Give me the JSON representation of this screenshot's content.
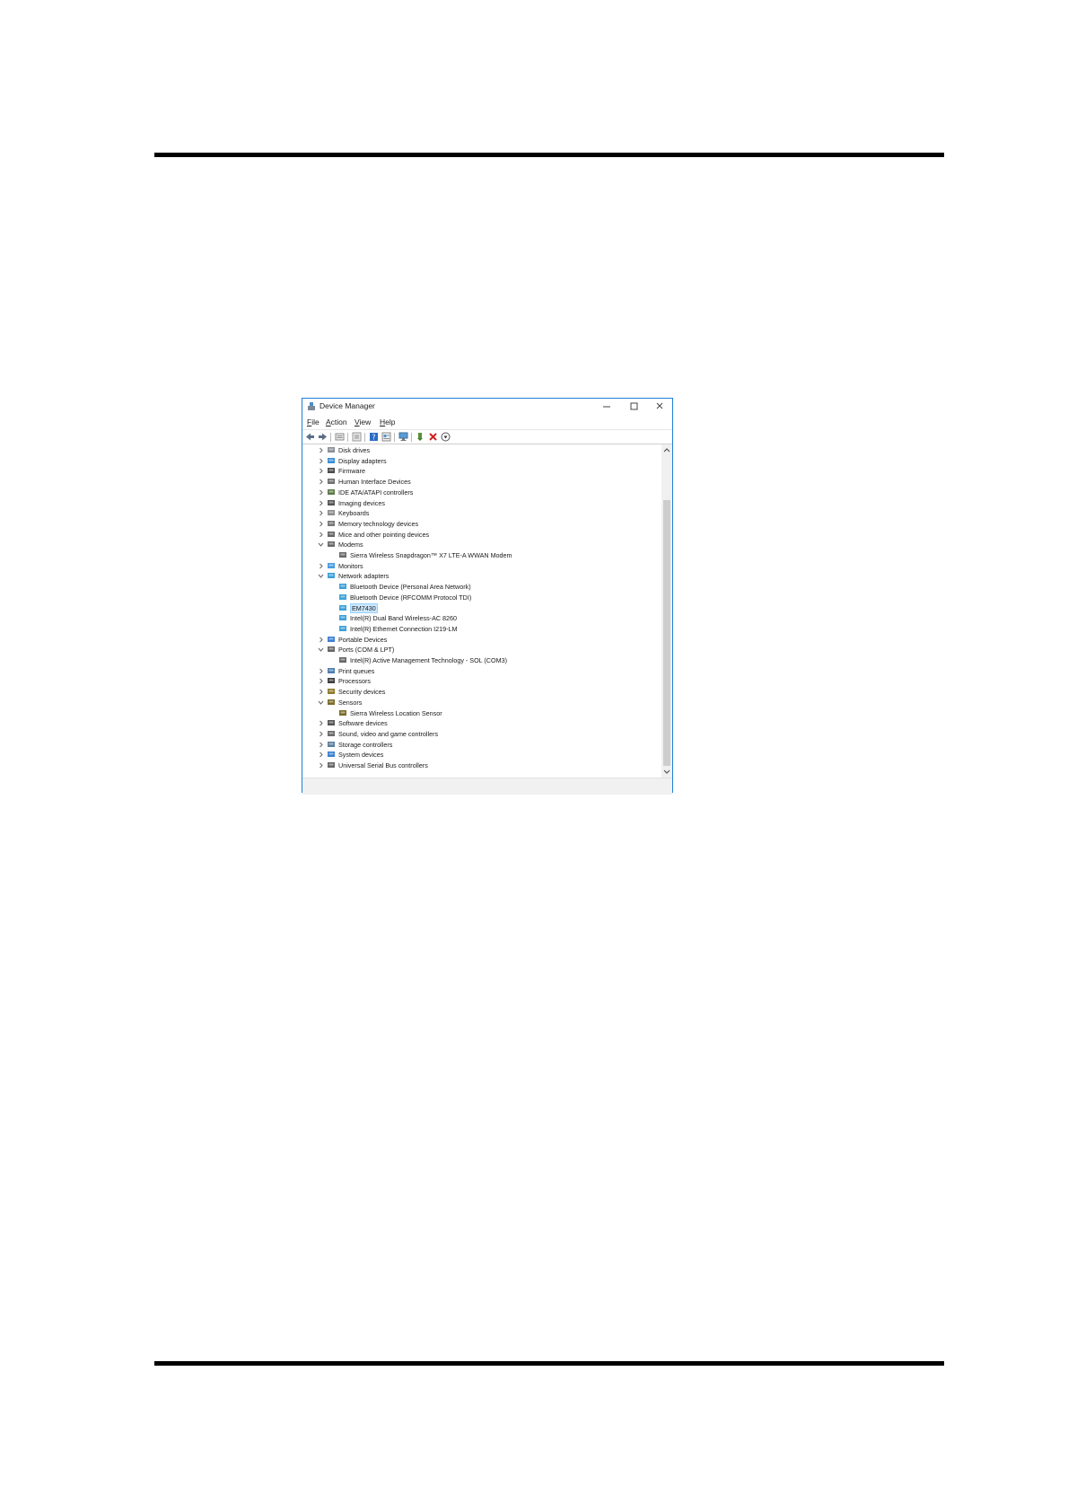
{
  "window": {
    "title": "Device Manager",
    "accent": "#1c7fd6",
    "selection_bg": "#cce8ff"
  },
  "menu": [
    {
      "label": "File",
      "mnemonic": "F",
      "rest": "ile"
    },
    {
      "label": "Action",
      "mnemonic": "A",
      "rest": "ction"
    },
    {
      "label": "View",
      "mnemonic": "V",
      "rest": "iew"
    },
    {
      "label": "Help",
      "mnemonic": "H",
      "rest": "elp"
    }
  ],
  "toolbar": [
    {
      "name": "back-arrow-icon"
    },
    {
      "name": "forward-arrow-icon"
    },
    {
      "name": "properties-icon"
    },
    {
      "name": "update-driver-icon"
    },
    {
      "name": "help-icon"
    },
    {
      "name": "details-view-icon"
    },
    {
      "name": "scan-hardware-icon"
    },
    {
      "name": "enable-device-icon"
    },
    {
      "name": "uninstall-device-icon"
    },
    {
      "name": "download-driver-icon"
    }
  ],
  "tree": [
    {
      "label": "Disk drives",
      "level": 0,
      "state": "collapsed",
      "icon": "disk-drive-icon"
    },
    {
      "label": "Display adapters",
      "level": 0,
      "state": "collapsed",
      "icon": "display-adapter-icon"
    },
    {
      "label": "Firmware",
      "level": 0,
      "state": "collapsed",
      "icon": "firmware-icon"
    },
    {
      "label": "Human Interface Devices",
      "level": 0,
      "state": "collapsed",
      "icon": "hid-icon"
    },
    {
      "label": "IDE ATA/ATAPI controllers",
      "level": 0,
      "state": "collapsed",
      "icon": "ide-controller-icon"
    },
    {
      "label": "Imaging devices",
      "level": 0,
      "state": "collapsed",
      "icon": "imaging-device-icon"
    },
    {
      "label": "Keyboards",
      "level": 0,
      "state": "collapsed",
      "icon": "keyboard-icon"
    },
    {
      "label": "Memory technology devices",
      "level": 0,
      "state": "collapsed",
      "icon": "memory-device-icon"
    },
    {
      "label": "Mice and other pointing devices",
      "level": 0,
      "state": "collapsed",
      "icon": "mouse-icon"
    },
    {
      "label": "Modems",
      "level": 0,
      "state": "expanded",
      "icon": "modem-icon"
    },
    {
      "label": "Sierra Wireless Snapdragon™ X7 LTE-A WWAN Modem",
      "level": 1,
      "state": "leaf",
      "icon": "modem-icon"
    },
    {
      "label": "Monitors",
      "level": 0,
      "state": "collapsed",
      "icon": "monitor-icon"
    },
    {
      "label": "Network adapters",
      "level": 0,
      "state": "expanded",
      "icon": "network-adapter-icon"
    },
    {
      "label": "Bluetooth Device (Personal Area Network)",
      "level": 1,
      "state": "leaf",
      "icon": "network-adapter-icon"
    },
    {
      "label": "Bluetooth Device (RFCOMM Protocol TDI)",
      "level": 1,
      "state": "leaf",
      "icon": "network-adapter-icon"
    },
    {
      "label": "EM7430",
      "level": 1,
      "state": "leaf",
      "icon": "network-adapter-icon",
      "selected": true
    },
    {
      "label": "Intel(R) Dual Band Wireless-AC 8260",
      "level": 1,
      "state": "leaf",
      "icon": "network-adapter-icon"
    },
    {
      "label": "Intel(R) Ethernet Connection I219-LM",
      "level": 1,
      "state": "leaf",
      "icon": "network-adapter-icon"
    },
    {
      "label": "Portable Devices",
      "level": 0,
      "state": "collapsed",
      "icon": "portable-device-icon"
    },
    {
      "label": "Ports (COM & LPT)",
      "level": 0,
      "state": "expanded",
      "icon": "port-icon"
    },
    {
      "label": "Intel(R) Active Management Technology - SOL (COM3)",
      "level": 1,
      "state": "leaf",
      "icon": "port-icon"
    },
    {
      "label": "Print queues",
      "level": 0,
      "state": "collapsed",
      "icon": "printer-icon"
    },
    {
      "label": "Processors",
      "level": 0,
      "state": "collapsed",
      "icon": "processor-icon"
    },
    {
      "label": "Security devices",
      "level": 0,
      "state": "collapsed",
      "icon": "security-device-icon"
    },
    {
      "label": "Sensors",
      "level": 0,
      "state": "expanded",
      "icon": "sensor-icon"
    },
    {
      "label": "Sierra Wireless Location Sensor",
      "level": 1,
      "state": "leaf",
      "icon": "sensor-icon"
    },
    {
      "label": "Software devices",
      "level": 0,
      "state": "collapsed",
      "icon": "software-device-icon"
    },
    {
      "label": "Sound, video and game controllers",
      "level": 0,
      "state": "collapsed",
      "icon": "sound-icon"
    },
    {
      "label": "Storage controllers",
      "level": 0,
      "state": "collapsed",
      "icon": "storage-controller-icon"
    },
    {
      "label": "System devices",
      "level": 0,
      "state": "collapsed",
      "icon": "system-device-icon"
    },
    {
      "label": "Universal Serial Bus controllers",
      "level": 0,
      "state": "collapsed",
      "icon": "usb-icon"
    }
  ]
}
